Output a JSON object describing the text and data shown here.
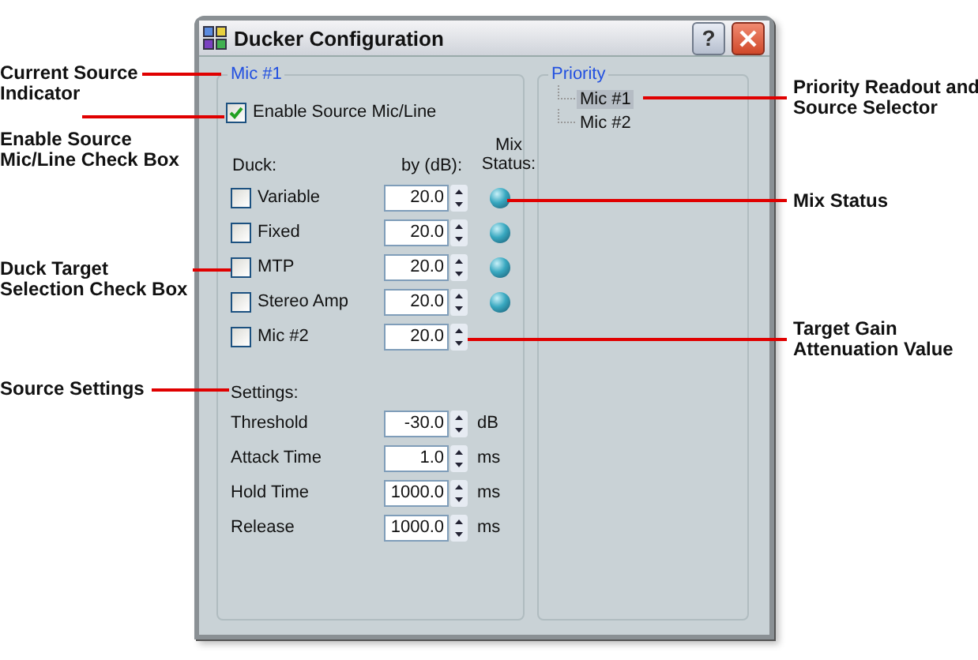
{
  "window": {
    "title": "Ducker Configuration",
    "help_button": "?"
  },
  "source_group": {
    "legend": "Mic #1",
    "enable": {
      "label": "Enable Source Mic/Line",
      "checked": true
    },
    "duck_header": "Duck:",
    "by_header": "by (dB):",
    "mix_header": "Mix Status:",
    "duck_targets": [
      {
        "label": "Variable",
        "checked": false,
        "value": "20.0",
        "mix_indicator": true
      },
      {
        "label": "Fixed",
        "checked": false,
        "value": "20.0",
        "mix_indicator": true
      },
      {
        "label": "MTP",
        "checked": false,
        "value": "20.0",
        "mix_indicator": true
      },
      {
        "label": "Stereo Amp",
        "checked": false,
        "value": "20.0",
        "mix_indicator": true
      },
      {
        "label": "Mic #2",
        "checked": false,
        "value": "20.0",
        "mix_indicator": false
      }
    ],
    "settings_label": "Settings:",
    "settings": [
      {
        "label": "Threshold",
        "value": "-30.0",
        "unit": "dB"
      },
      {
        "label": "Attack Time",
        "value": "1.0",
        "unit": "ms"
      },
      {
        "label": "Hold Time",
        "value": "1000.0",
        "unit": "ms"
      },
      {
        "label": "Release",
        "value": "1000.0",
        "unit": "ms"
      }
    ]
  },
  "priority": {
    "legend": "Priority",
    "items": [
      {
        "label": "Mic #1",
        "selected": true
      },
      {
        "label": "Mic #2",
        "selected": false
      }
    ]
  },
  "callouts": [
    {
      "lines": [
        "Current Source",
        "Indicator"
      ]
    },
    {
      "lines": [
        "Enable Source",
        "Mic/Line Check Box"
      ]
    },
    {
      "lines": [
        "Duck Target",
        "Selection Check Box"
      ]
    },
    {
      "lines": [
        "Source Settings"
      ]
    },
    {
      "lines": [
        "Priority Readout and",
        "Source Selector"
      ]
    },
    {
      "lines": [
        "Mix Status"
      ]
    },
    {
      "lines": [
        "Target Gain",
        "Attenuation Value"
      ]
    }
  ]
}
